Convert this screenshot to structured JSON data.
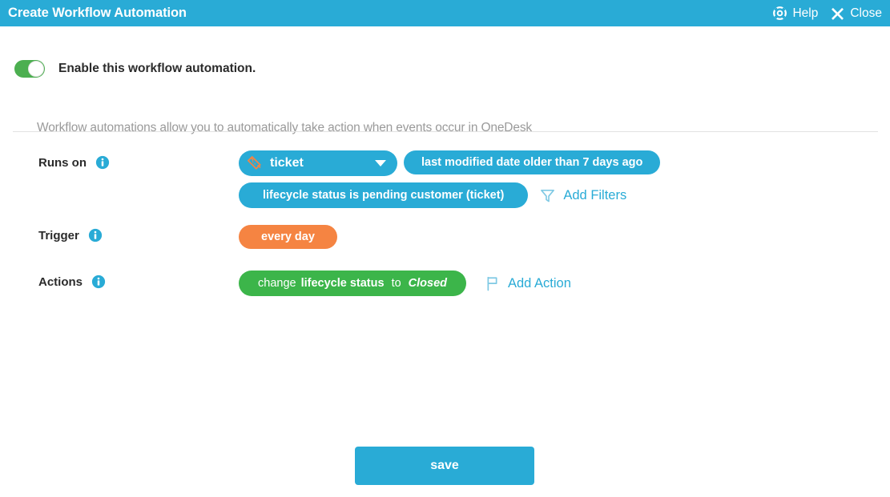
{
  "window": {
    "title": "Create Workflow Automation",
    "help_label": "Help",
    "close_label": "Close",
    "help_icon": "life-ring-icon",
    "close_icon": "close-x-icon",
    "header_color": "#29ABD6"
  },
  "enable": {
    "label": "Enable this workflow automation.",
    "state": "on",
    "toggle_color": "#4CAF50"
  },
  "description": "Workflow automations allow you to automatically take action when events occur in OneDesk",
  "rows": {
    "runs_on": {
      "label": "Runs on",
      "info_icon": "info-icon",
      "type_pill": {
        "icon": "ticket-icon",
        "label": "ticket",
        "caret_icon": "chevron-down-icon",
        "color": "#29ABD6"
      },
      "filters": [
        {
          "label": "last modified date older than 7 days ago",
          "color": "#29ABD6"
        },
        {
          "label": "lifecycle status is pending customer (ticket)",
          "color": "#29ABD6"
        }
      ],
      "add_filters": {
        "label": "Add Filters",
        "icon": "funnel-icon",
        "color": "#29ABD6"
      }
    },
    "trigger": {
      "label": "Trigger",
      "info_icon": "info-icon",
      "pill": {
        "label": "every day",
        "color": "#F58442"
      }
    },
    "actions": {
      "label": "Actions",
      "info_icon": "info-icon",
      "pill": {
        "verb": "change",
        "field": "lifecycle status",
        "to": "to",
        "value": "Closed",
        "color": "#3CB54A"
      },
      "add_action": {
        "label": "Add Action",
        "icon": "flag-icon",
        "color": "#29ABD6"
      }
    }
  },
  "footer": {
    "save_label": "save",
    "save_color": "#29ABD6"
  }
}
